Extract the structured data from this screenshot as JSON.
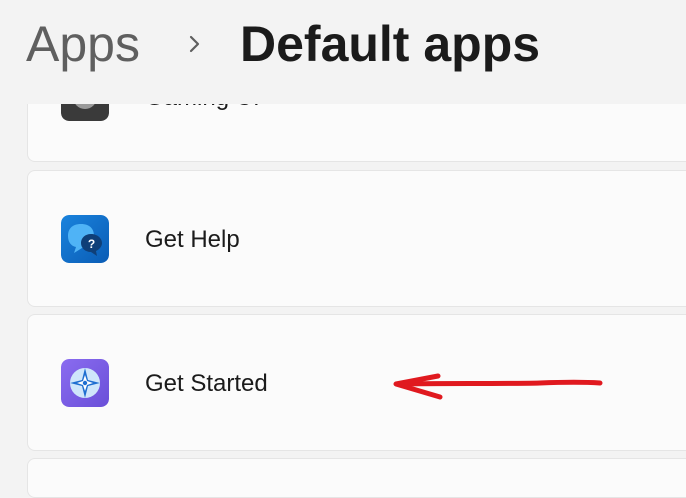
{
  "breadcrumb": {
    "parent": "Apps",
    "current": "Default apps"
  },
  "apps": [
    {
      "label": "Gaming UI",
      "icon": "gaming-app-icon"
    },
    {
      "label": "Get Help",
      "icon": "get-help-app-icon"
    },
    {
      "label": "Get Started",
      "icon": "get-started-app-icon"
    }
  ],
  "annotation": {
    "icon": "red-arrow-annotation",
    "color": "#e0191f"
  },
  "colors": {
    "background": "#f3f3f3",
    "card": "#fbfbfb",
    "card_border": "#e5e5e5",
    "get_help_blue": "#0a67c4",
    "get_started_purple": "#7b5ce6"
  }
}
